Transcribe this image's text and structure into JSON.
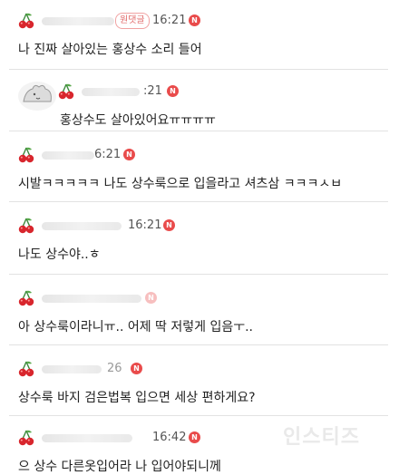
{
  "comments": [
    {
      "badge": "원댓글",
      "time": "16:21",
      "new_mark": "N",
      "text": "나 진짜 살아있는 홍상수 소리 들어"
    },
    {
      "time": ":21",
      "new_mark": "N",
      "text": "홍상수도 살아있어요ㅠㅠㅠㅠ"
    },
    {
      "time": "6:21",
      "new_mark": "N",
      "text": "시발ㅋㅋㅋㅋㅋ 나도 상수룩으로 입을라고 셔츠삼 ㅋㅋㅋㅅㅂ"
    },
    {
      "time": "16:21",
      "new_mark": "N",
      "text": "나도 상수야..ㅎ"
    },
    {
      "new_mark": "N",
      "text": "아 상수룩이라니ㅠ.. 어제 딱 저렇게 입음ㅜ.."
    },
    {
      "time": "26",
      "new_mark": "N",
      "text": "상수룩 바지 검은법복 입으면 세상 편하게요?"
    },
    {
      "time": "16:42",
      "new_mark": "N",
      "text": "으 상수 다른옷입어라 나 입어야되니께"
    }
  ],
  "watermark": "인스티즈",
  "colors": {
    "accent": "#e94b4b",
    "divider": "#e2e2e2"
  }
}
